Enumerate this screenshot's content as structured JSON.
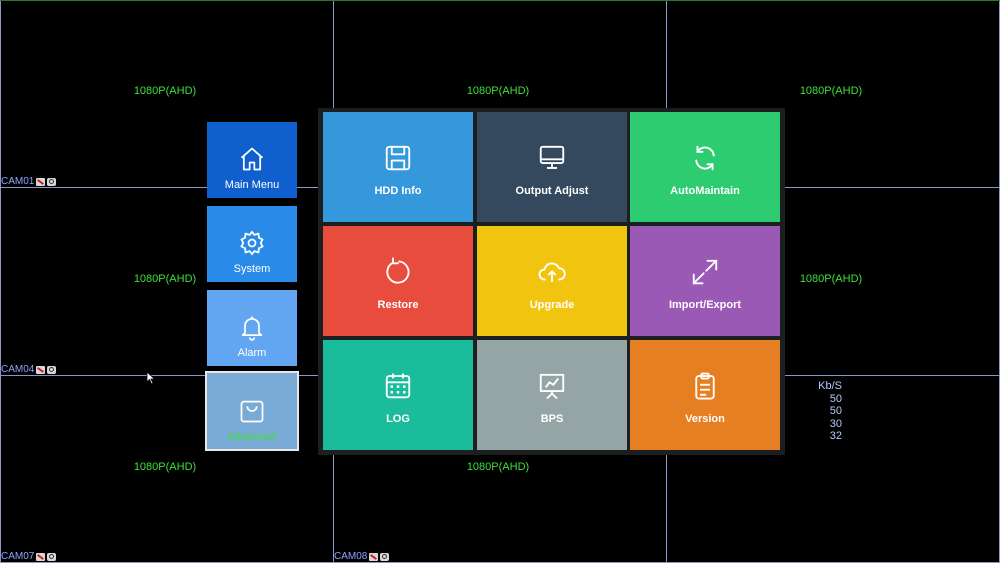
{
  "channels": {
    "resolution_labels": [
      "1080P(AHD)",
      "1080P(AHD)",
      "1080P(AHD)",
      "1080P(AHD)",
      "1080P(AHD)",
      "1080P(AHD)",
      "1080P(AHD)"
    ],
    "cam_labels": {
      "cam01": "CAM01",
      "cam04": "CAM04",
      "cam07": "CAM07",
      "cam08": "CAM08"
    }
  },
  "side_menu": {
    "items": [
      {
        "label": "Main Menu",
        "icon": "home-icon",
        "color": "#0f5fcf"
      },
      {
        "label": "System",
        "icon": "gear-icon",
        "color": "#2a8ae8"
      },
      {
        "label": "Alarm",
        "icon": "bell-icon",
        "color": "#62a6f2"
      },
      {
        "label": "Advanced",
        "icon": "bag-icon",
        "color": "#7aaad6",
        "text_color": "#3de03d"
      }
    ]
  },
  "tiles": [
    {
      "label": "HDD Info",
      "icon": "floppy-icon",
      "color": "#3498db"
    },
    {
      "label": "Output Adjust",
      "icon": "monitor-icon",
      "color": "#34495e"
    },
    {
      "label": "AutoMaintain",
      "icon": "refresh-icon",
      "color": "#2ecc71"
    },
    {
      "label": "Restore",
      "icon": "restore-icon",
      "color": "#e74c3c"
    },
    {
      "label": "Upgrade",
      "icon": "cloud-upload-icon",
      "color": "#f1c40f"
    },
    {
      "label": "Import/Export",
      "icon": "expand-arrows-icon",
      "color": "#9b59b6"
    },
    {
      "label": "LOG",
      "icon": "calendar-icon",
      "color": "#1abc9c"
    },
    {
      "label": "BPS",
      "icon": "presentation-chart-icon",
      "color": "#95a5a6"
    },
    {
      "label": "Version",
      "icon": "clipboard-icon",
      "color": "#e67e22"
    }
  ],
  "bitrate": {
    "unit": "Kb/S",
    "values": [
      "50",
      "50",
      "30",
      "32"
    ]
  }
}
